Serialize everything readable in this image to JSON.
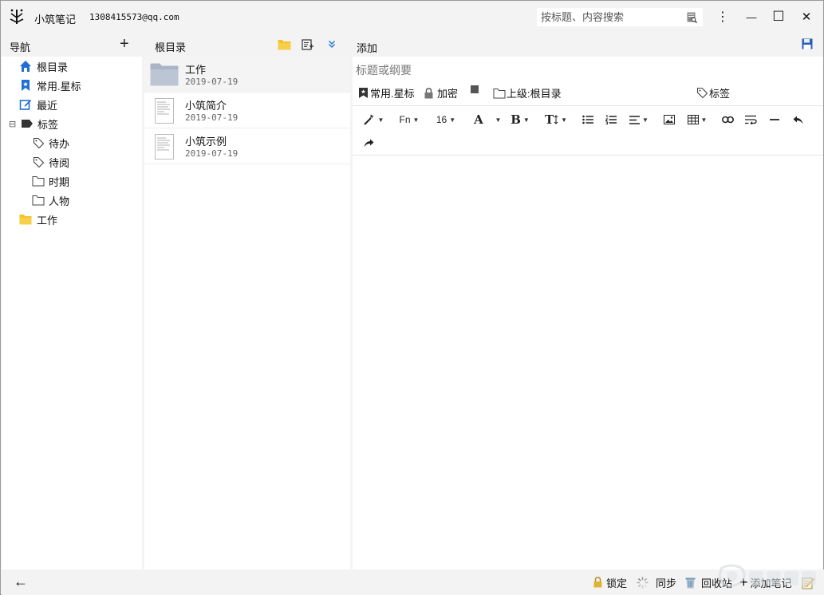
{
  "app": {
    "name": "小筑笔记",
    "account": "1308415573@qq.com"
  },
  "search": {
    "placeholder": "按标题、内容搜索"
  },
  "window_controls": {
    "menu": "⋮",
    "minimize": "—",
    "maximize": "☐",
    "close": "✕"
  },
  "nav": {
    "title": "导航",
    "add": "+",
    "items": [
      {
        "label": "根目录",
        "icon": "home-icon"
      },
      {
        "label": "常用.星标",
        "icon": "bookmark-star-icon"
      },
      {
        "label": "最近",
        "icon": "edit-icon"
      },
      {
        "label": "标签",
        "icon": "tag-icon",
        "expand": "⊟"
      },
      {
        "label": "待办",
        "icon": "tag-outline-icon"
      },
      {
        "label": "待阅",
        "icon": "tag-outline-icon"
      },
      {
        "label": "时期",
        "icon": "folder-outline-icon"
      },
      {
        "label": "人物",
        "icon": "folder-outline-icon"
      },
      {
        "label": "工作",
        "icon": "folder-yellow-icon"
      }
    ]
  },
  "list": {
    "title": "根目录",
    "notes": [
      {
        "title": "工作",
        "date": "2019-07-19",
        "kind": "folder"
      },
      {
        "title": "小筑简介",
        "date": "2019-07-19",
        "kind": "document"
      },
      {
        "title": "小筑示例",
        "date": "2019-07-19",
        "kind": "document"
      }
    ]
  },
  "editor": {
    "title": "添加",
    "title_placeholder": "标题或纲要",
    "meta": {
      "favorite": "常用.星标",
      "encrypt": "加密",
      "parent": "上级:根目录",
      "tags": "标签"
    },
    "toolbar": {
      "font": "Fn",
      "size": "16",
      "color": "A",
      "bold": "B",
      "text_size": "T"
    }
  },
  "status": {
    "back": "←",
    "lock": "锁定",
    "sync": "同步",
    "trash": "回收站",
    "add_note": "添加笔记"
  },
  "colors": {
    "accent_blue": "#1f6fd6",
    "folder_yellow": "#f5c22c",
    "folder_gray": "#aab4c6",
    "chrome": "#f3f3f3"
  }
}
